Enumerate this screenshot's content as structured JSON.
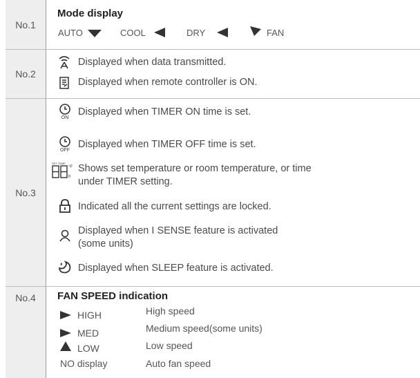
{
  "rows": {
    "r1": {
      "num": "No.1",
      "title": "Mode display",
      "modes": [
        "AUTO",
        "COOL",
        "DRY",
        "FAN"
      ]
    },
    "r2": {
      "num": "No.2",
      "items": [
        {
          "icon": "transmit-icon",
          "text": "Displayed when data transmitted."
        },
        {
          "icon": "remote-on-icon",
          "text": "Displayed when remote controller is ON."
        }
      ]
    },
    "r3": {
      "num": "No.3",
      "items": [
        {
          "icon": "timer-on-icon",
          "icon_label": "ON",
          "text": "Displayed when TIMER ON time is set."
        },
        {
          "icon": "timer-off-icon",
          "icon_label": "OFF",
          "text": "Displayed when TIMER OFF time is set."
        },
        {
          "icon": "temperature-display-icon",
          "icon_label_top": "SET TEMP",
          "icon_label_f": "°F",
          "icon_label_h": "h",
          "text_line1": "Shows set temperature or room temperature, or time",
          "text_line2": "under TIMER setting."
        },
        {
          "icon": "lock-icon",
          "text": "Indicated all the current settings are locked."
        },
        {
          "icon": "person-icon",
          "text_line1": "Displayed when I SENSE feature is activated",
          "text_line2": "(some units)"
        },
        {
          "icon": "sleep-icon",
          "text": "Displayed when SLEEP feature is activated."
        }
      ]
    },
    "r4": {
      "num": "No.4",
      "title": "FAN SPEED indication",
      "speeds": [
        {
          "label": "HIGH",
          "desc": "High speed"
        },
        {
          "label": "MED",
          "desc": "Medium speed(some units)"
        },
        {
          "label": "LOW",
          "desc": "Low speed"
        },
        {
          "label": "NO display",
          "desc": "Auto fan speed"
        }
      ]
    }
  },
  "colors": {
    "text": "#4a4a4a",
    "border": "#bdbdbd",
    "shade": "#eeeeee",
    "icon": "#333333"
  }
}
